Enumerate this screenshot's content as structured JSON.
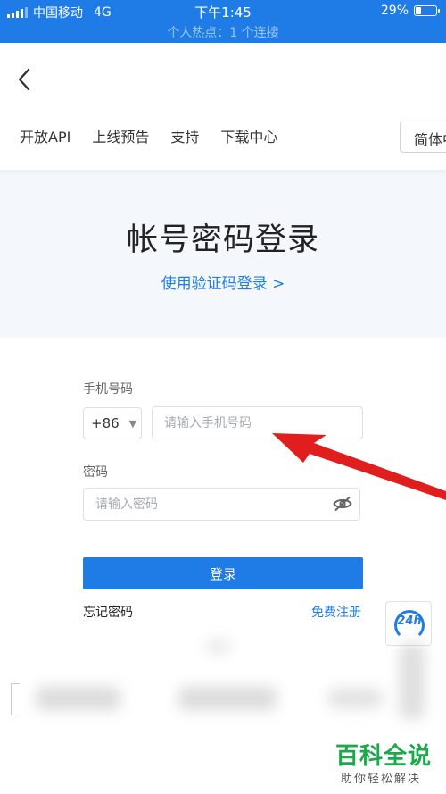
{
  "status_bar": {
    "carrier": "中国移动",
    "network": "4G",
    "time": "下午1:45",
    "hotspot": "个人热点：1 个连接",
    "battery": "29%",
    "battery_level": 0.29
  },
  "header": {
    "nav": [
      "开放API",
      "上线预告",
      "支持",
      "下载中心"
    ],
    "language": "简体中文"
  },
  "hero": {
    "title": "帐号密码登录",
    "switch_link": "使用验证码登录 >"
  },
  "form": {
    "phone_label": "手机号码",
    "country_code": "+86",
    "phone_placeholder": "请输入手机号码",
    "password_label": "密码",
    "password_placeholder": "请输入密码",
    "submit": "登录",
    "forgot": "忘记密码",
    "register": "免费注册"
  },
  "service_badge": "24h",
  "watermark": {
    "title": "百科全说",
    "subtitle": "助你轻松解决"
  },
  "colors": {
    "accent": "#1f7ce6",
    "arrow": "#e01e1e",
    "watermark": "#1ca94b"
  }
}
